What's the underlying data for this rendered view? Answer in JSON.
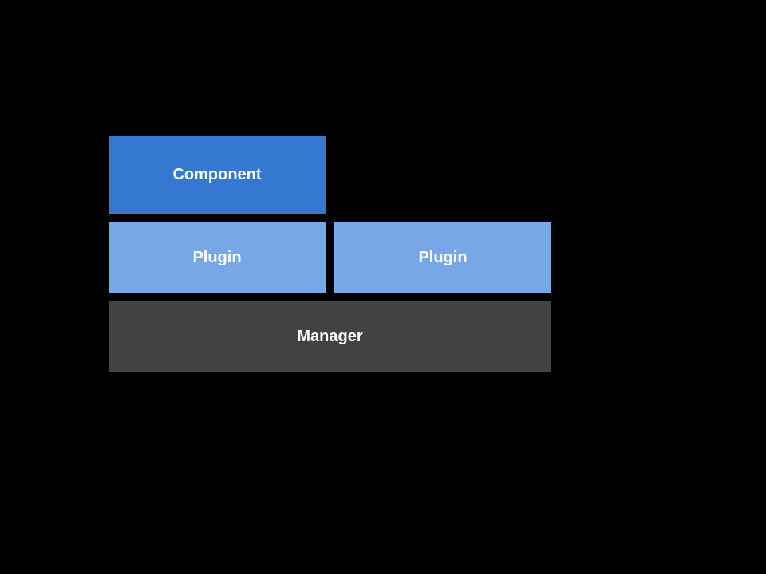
{
  "component": {
    "label": "Component"
  },
  "plugin_left": {
    "label": "Plugin"
  },
  "plugin_right": {
    "label": "Plugin"
  },
  "manager": {
    "label": "Manager"
  },
  "colors": {
    "component_bg": "#3478d1",
    "plugin_bg": "#78a7e8",
    "manager_bg": "#424242",
    "text": "#ffffff",
    "page_bg": "#000000"
  }
}
